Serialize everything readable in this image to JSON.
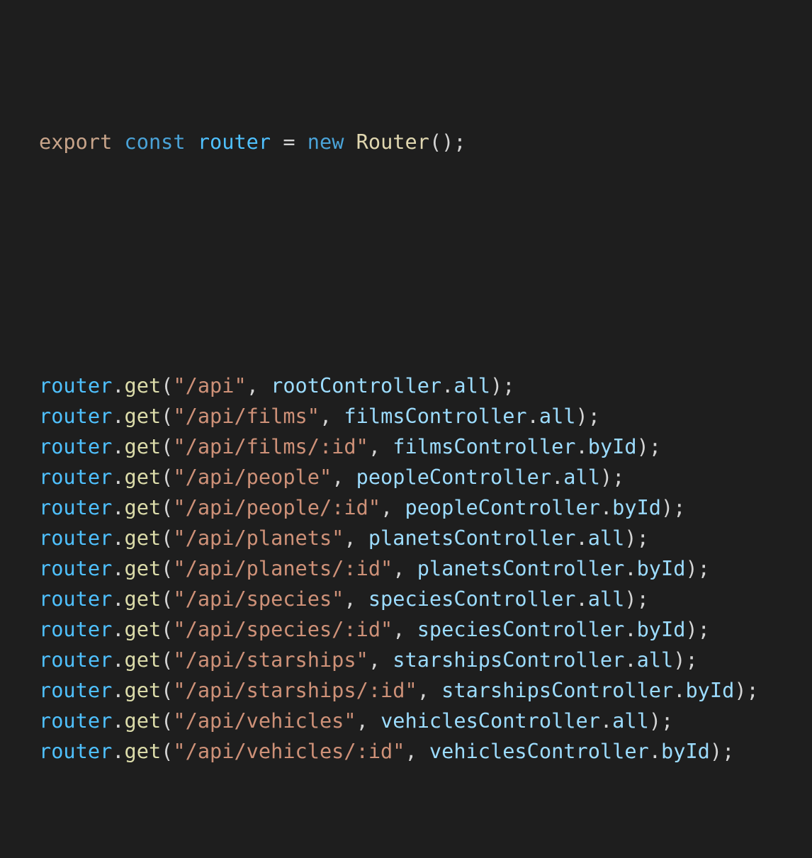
{
  "editor": {
    "background": "#1e1e1e",
    "colors": {
      "keyword_export": "#c8a48a",
      "keyword_decl": "#4aa3d8",
      "variable": "#4fc1ff",
      "function": "#dcdcaa",
      "string": "#ce9178",
      "property": "#9cdcfe",
      "plain": "#d4d4d4"
    },
    "first_line": {
      "kw_export": "export",
      "kw_const": "const",
      "var_name": "router",
      "equals": " = ",
      "kw_new": "new",
      "class_name": "Router",
      "tail": "();"
    },
    "routes": [
      {
        "obj": "router",
        "method": "get",
        "path": "\"/api\"",
        "controller": "rootController",
        "action": "all"
      },
      {
        "obj": "router",
        "method": "get",
        "path": "\"/api/films\"",
        "controller": "filmsController",
        "action": "all"
      },
      {
        "obj": "router",
        "method": "get",
        "path": "\"/api/films/:id\"",
        "controller": "filmsController",
        "action": "byId"
      },
      {
        "obj": "router",
        "method": "get",
        "path": "\"/api/people\"",
        "controller": "peopleController",
        "action": "all"
      },
      {
        "obj": "router",
        "method": "get",
        "path": "\"/api/people/:id\"",
        "controller": "peopleController",
        "action": "byId"
      },
      {
        "obj": "router",
        "method": "get",
        "path": "\"/api/planets\"",
        "controller": "planetsController",
        "action": "all"
      },
      {
        "obj": "router",
        "method": "get",
        "path": "\"/api/planets/:id\"",
        "controller": "planetsController",
        "action": "byId"
      },
      {
        "obj": "router",
        "method": "get",
        "path": "\"/api/species\"",
        "controller": "speciesController",
        "action": "all"
      },
      {
        "obj": "router",
        "method": "get",
        "path": "\"/api/species/:id\"",
        "controller": "speciesController",
        "action": "byId"
      },
      {
        "obj": "router",
        "method": "get",
        "path": "\"/api/starships\"",
        "controller": "starshipsController",
        "action": "all"
      },
      {
        "obj": "router",
        "method": "get",
        "path": "\"/api/starships/:id\"",
        "controller": "starshipsController",
        "action": "byId"
      },
      {
        "obj": "router",
        "method": "get",
        "path": "\"/api/vehicles\"",
        "controller": "vehiclesController",
        "action": "all"
      },
      {
        "obj": "router",
        "method": "get",
        "path": "\"/api/vehicles/:id\"",
        "controller": "vehiclesController",
        "action": "byId"
      }
    ]
  }
}
